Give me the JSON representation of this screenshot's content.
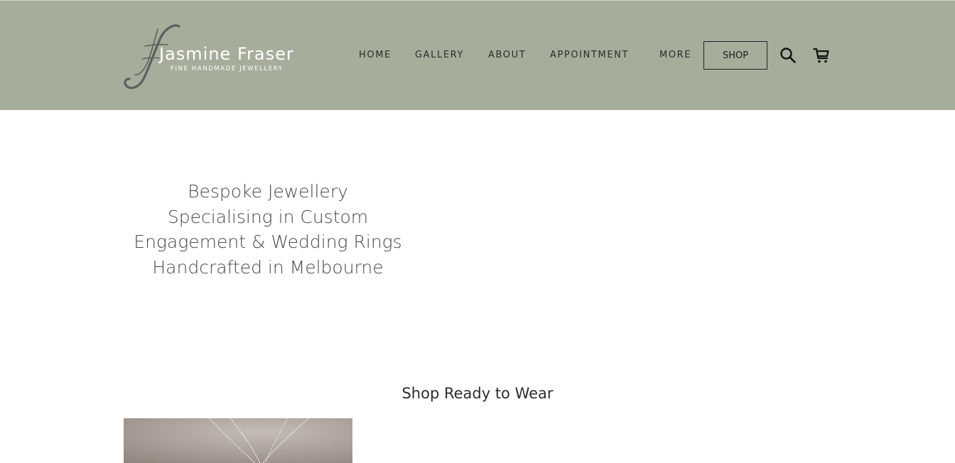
{
  "brand": {
    "name": "Jasmine Fraser",
    "tagline": "FINE HANDMADE JEWELLERY"
  },
  "nav": {
    "items": [
      {
        "label": "HOME"
      },
      {
        "label": "GALLERY"
      },
      {
        "label": "ABOUT"
      },
      {
        "label": "APPOINTMENT"
      },
      {
        "label": "MORE"
      }
    ],
    "shop_label": "SHOP"
  },
  "icons": {
    "search": "search-icon",
    "cart": "cart-icon"
  },
  "hero": {
    "lines": [
      "Bespoke Jewellery",
      "Specialising in Custom",
      "Engagement & Wedding Rings",
      "Handcrafted in Melbourne"
    ]
  },
  "shop_section": {
    "title": "Shop Ready to Wear"
  },
  "colors": {
    "header_bg": "#a6ae9b",
    "text_dark": "#2b2b2b",
    "hero_text": "#4a4a4a"
  }
}
